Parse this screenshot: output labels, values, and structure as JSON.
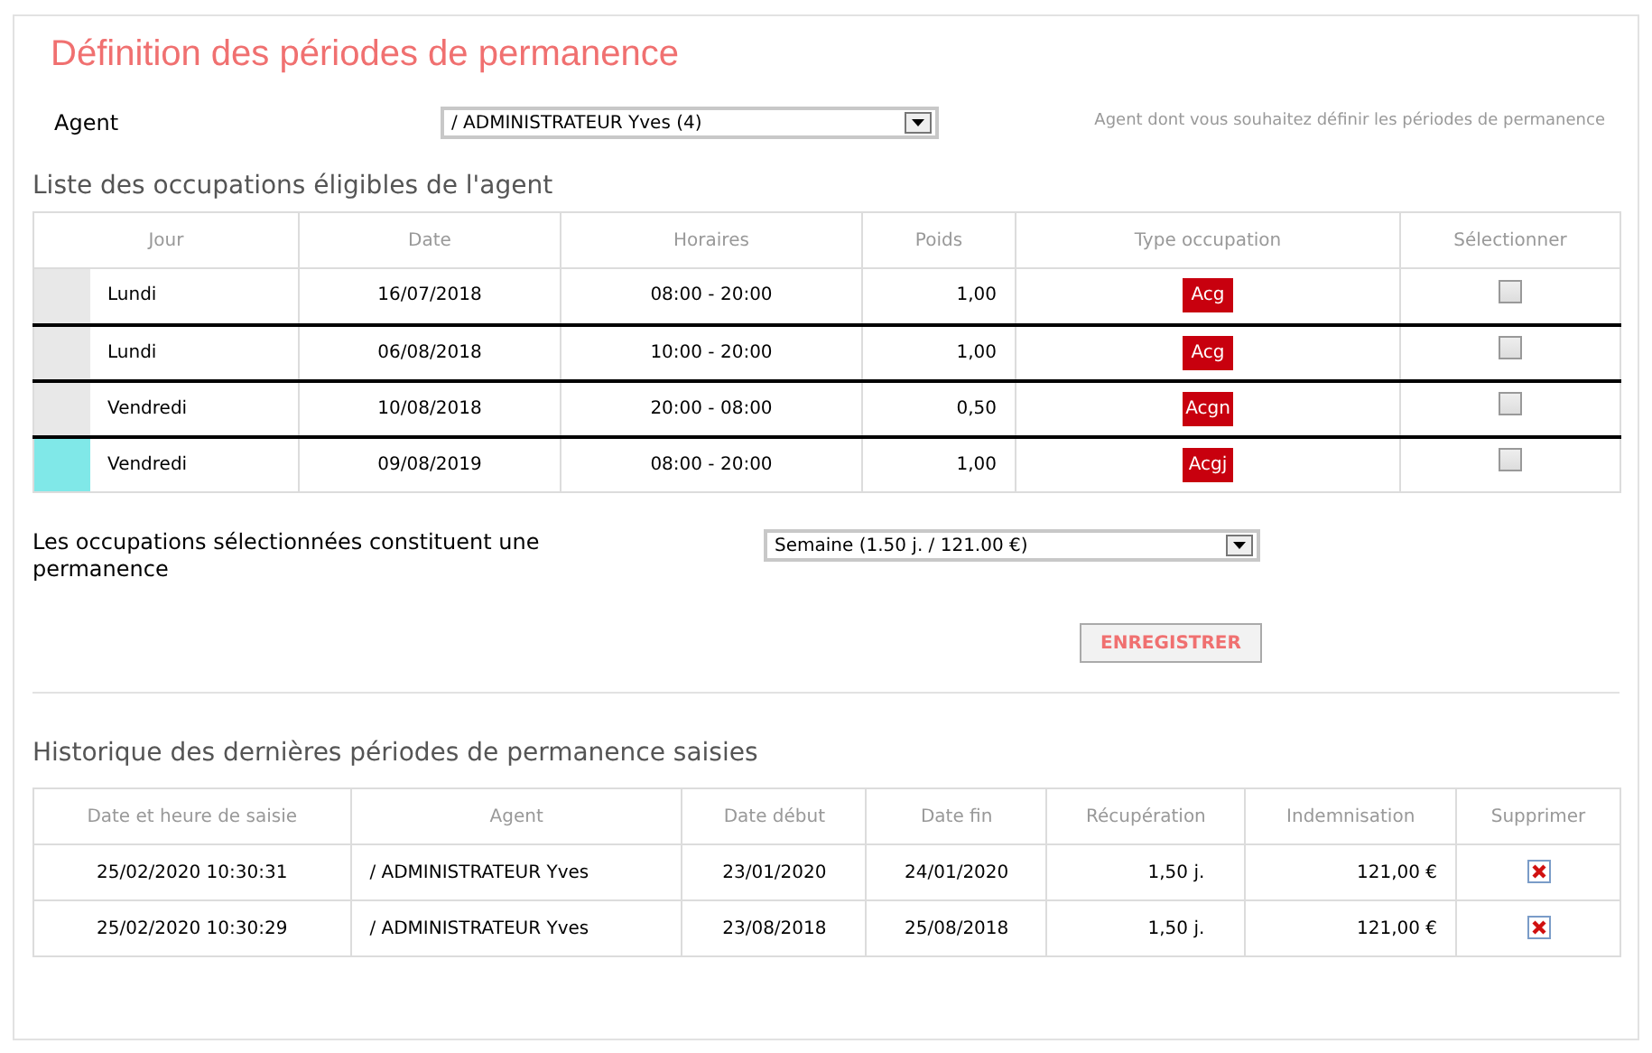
{
  "title": "Définition des périodes de permanence",
  "agent": {
    "label": "Agent",
    "value": "/ ADMINISTRATEUR Yves (4)",
    "help": "Agent dont vous souhaitez définir les périodes de permanence"
  },
  "occupations": {
    "title": "Liste des occupations éligibles de l'agent",
    "columns": [
      "Jour",
      "Date",
      "Horaires",
      "Poids",
      "Type occupation",
      "Sélectionner"
    ],
    "rows": [
      {
        "color": "#e8e8e8",
        "day": "Lundi",
        "date": "16/07/2018",
        "hours": "08:00 - 20:00",
        "weight": "1,00",
        "type": "Acg",
        "checked": false
      },
      {
        "color": "#e8e8e8",
        "day": "Lundi",
        "date": "06/08/2018",
        "hours": "10:00 - 20:00",
        "weight": "1,00",
        "type": "Acg",
        "checked": false
      },
      {
        "color": "#e8e8e8",
        "day": "Vendredi",
        "date": "10/08/2018",
        "hours": "20:00 - 08:00",
        "weight": "0,50",
        "type": "Acgn",
        "checked": false
      },
      {
        "color": "#80e8e8",
        "day": "Vendredi",
        "date": "09/08/2019",
        "hours": "08:00 - 20:00",
        "weight": "1,00",
        "type": "Acgj",
        "checked": false
      }
    ]
  },
  "permanence": {
    "label": "Les occupations sélectionnées constituent une permanence",
    "value": "Semaine (1.50 j. / 121.00 €)"
  },
  "save_button": "ENREGISTRER",
  "history": {
    "title": "Historique des dernières périodes de permanence saisies",
    "columns": [
      "Date et heure de saisie",
      "Agent",
      "Date début",
      "Date fin",
      "Récupération",
      "Indemnisation",
      "Supprimer"
    ],
    "rows": [
      [
        "25/02/2020 10:30:31",
        "/ ADMINISTRATEUR Yves",
        "23/01/2020",
        "24/01/2020",
        "1,50 j.",
        "121,00 €"
      ],
      [
        "25/02/2020 10:30:29",
        "/ ADMINISTRATEUR Yves",
        "23/08/2018",
        "25/08/2018",
        "1,50 j.",
        "121,00 €"
      ]
    ]
  }
}
